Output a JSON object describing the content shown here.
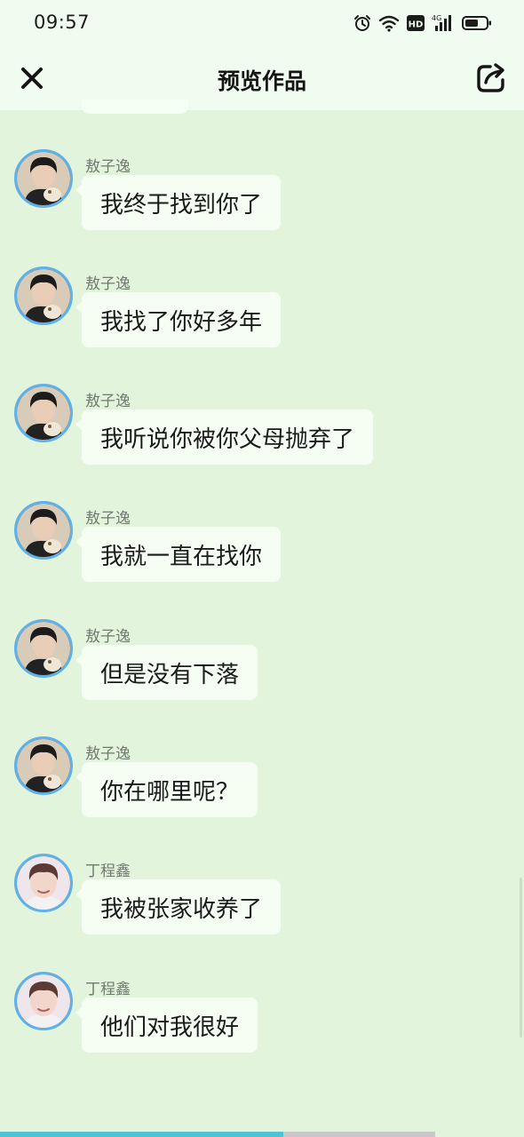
{
  "status_bar": {
    "time": "09:57",
    "icons": [
      "alarm-icon",
      "wifi-icon",
      "hd-icon",
      "signal-4g-icon",
      "battery-icon"
    ],
    "network_badge": "4G",
    "hd_badge": "HD"
  },
  "header": {
    "title": "预览作品",
    "left_icon": "close-icon",
    "right_icon": "share-icon"
  },
  "messages": [
    {
      "sender": "敖子逸",
      "text": "我终于找到你了",
      "avatar": "avatar-aoziyi"
    },
    {
      "sender": "敖子逸",
      "text": "我找了你好多年",
      "avatar": "avatar-aoziyi"
    },
    {
      "sender": "敖子逸",
      "text": "我听说你被你父母抛弃了",
      "avatar": "avatar-aoziyi"
    },
    {
      "sender": "敖子逸",
      "text": "我就一直在找你",
      "avatar": "avatar-aoziyi"
    },
    {
      "sender": "敖子逸",
      "text": "但是没有下落",
      "avatar": "avatar-aoziyi"
    },
    {
      "sender": "敖子逸",
      "text": "你在哪里呢？",
      "avatar": "avatar-aoziyi"
    },
    {
      "sender": "丁程鑫",
      "text": "我被张家收养了",
      "avatar": "avatar-dingchengxin"
    },
    {
      "sender": "丁程鑫",
      "text": "他们对我很好",
      "avatar": "avatar-dingchengxin"
    }
  ],
  "colors": {
    "background": "#e3f4dd",
    "bar": "#f1fcf0",
    "bubble": "#f6fef4",
    "avatar_ring": "#5fb1ea",
    "progress_played": "#4cc3d6",
    "progress_rest": "#c9c9c9"
  },
  "playback_progress": 0.54
}
